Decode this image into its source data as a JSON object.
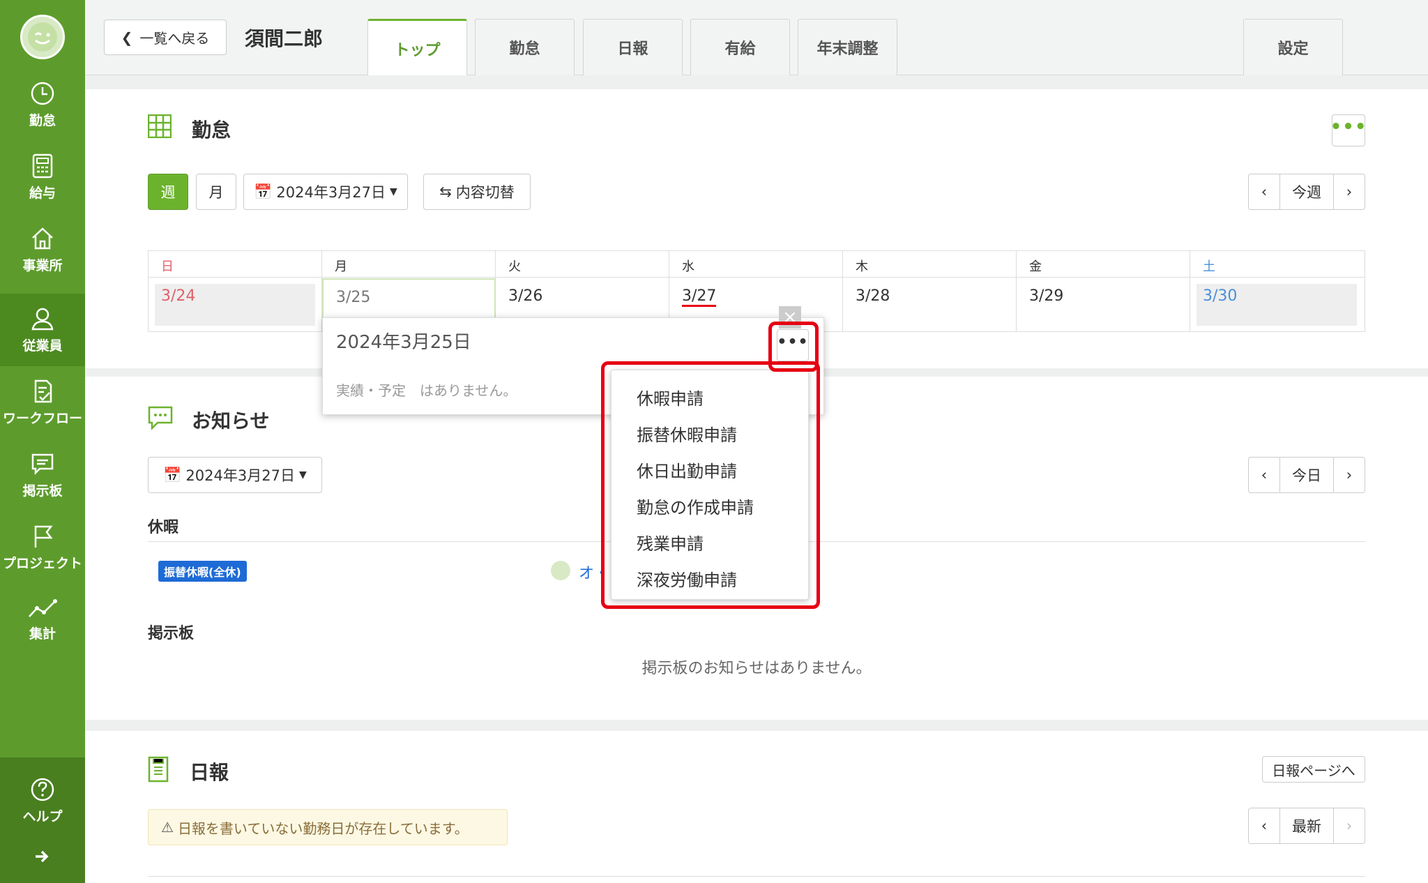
{
  "sidebar": {
    "items": [
      {
        "label": "勤怠",
        "icon": "clock-icon"
      },
      {
        "label": "給与",
        "icon": "calculator-icon"
      },
      {
        "label": "事業所",
        "icon": "home-icon"
      },
      {
        "label": "従業員",
        "icon": "person-icon"
      },
      {
        "label": "ワークフロー",
        "icon": "checklist-icon"
      },
      {
        "label": "掲示板",
        "icon": "chat-icon"
      },
      {
        "label": "プロジェクト",
        "icon": "flag-icon"
      },
      {
        "label": "集計",
        "icon": "chart-line-icon"
      }
    ],
    "help_label": "ヘルプ",
    "expand_icon": "arrow-right-icon"
  },
  "header": {
    "back_label": "一覧へ戻る",
    "employee_name": "須間二郎",
    "tabs": [
      "トップ",
      "勤怠",
      "日報",
      "有給",
      "年末調整"
    ],
    "settings_label": "設定"
  },
  "attendance": {
    "title": "勤怠",
    "view_week": "週",
    "view_month": "月",
    "date_picker": "2024年3月27日",
    "toggle_label": "内容切替",
    "nav_label": "今週",
    "days": [
      {
        "head": "日",
        "date": "3/24"
      },
      {
        "head": "月",
        "date": "3/25"
      },
      {
        "head": "火",
        "date": "3/26"
      },
      {
        "head": "水",
        "date": "3/27"
      },
      {
        "head": "木",
        "date": "3/28"
      },
      {
        "head": "金",
        "date": "3/29"
      },
      {
        "head": "土",
        "date": "3/30"
      }
    ]
  },
  "popup": {
    "date": "2024年3月25日",
    "empty_message": "実績・予定　はありません。"
  },
  "menu": {
    "items": [
      "休暇申請",
      "振替休暇申請",
      "休日出勤申請",
      "勤怠の作成申請",
      "残業申請",
      "深夜労働申請"
    ]
  },
  "notices": {
    "title": "お知らせ",
    "date_picker": "2024年3月27日",
    "nav_label": "今日",
    "leave_heading": "休暇",
    "leave_badge": "振替休暇(全休)",
    "leave_person": "オ・",
    "board_heading": "掲示板",
    "board_empty": "掲示板のお知らせはありません。"
  },
  "daily_report": {
    "title": "日報",
    "page_link": "日報ページへ",
    "warning": "日報を書いていない勤務日が存在しています。",
    "nav_label": "最新"
  },
  "colors": {
    "sidebar": "#5d9c2c",
    "accent": "#6cb32d",
    "sunday": "#e0606a",
    "saturday": "#4a90d9",
    "highlight": "#e60012"
  }
}
